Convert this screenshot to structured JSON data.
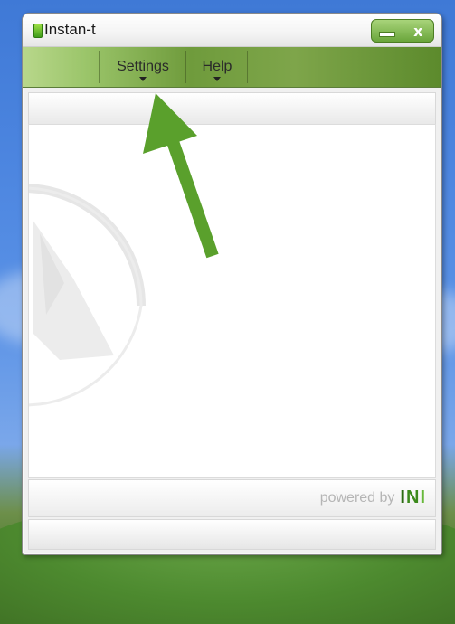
{
  "window": {
    "title": "Instan-t",
    "controls": {
      "minimize_icon": "minimize-icon",
      "close_label": "x"
    }
  },
  "menu": {
    "items": [
      {
        "label": "Settings",
        "icon": "chevron-down-icon"
      },
      {
        "label": "Help",
        "icon": "chevron-down-icon"
      }
    ]
  },
  "footer": {
    "powered_by": "powered by",
    "brand": {
      "part1": "I",
      "part2": "N",
      "part3": "I"
    }
  },
  "colors": {
    "menubar_accent": "#6f9b3c",
    "annotation_arrow": "#5aa02c",
    "brand_dark": "#2c6b12",
    "brand_light": "#67b83a"
  }
}
